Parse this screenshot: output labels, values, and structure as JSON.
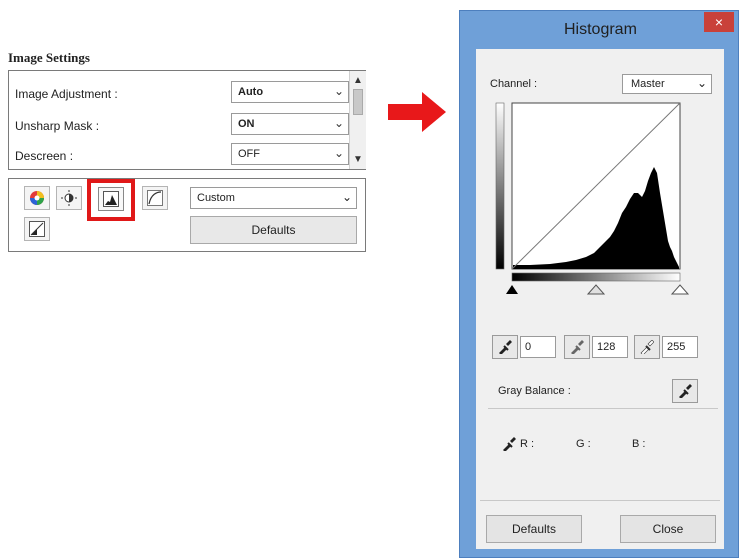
{
  "image_settings": {
    "title": "Image Settings",
    "rows": [
      {
        "label": "Image Adjustment :",
        "value": "Auto"
      },
      {
        "label": "Unsharp Mask :",
        "value": "ON"
      },
      {
        "label": "Descreen :",
        "value": "OFF"
      }
    ],
    "tone_preset": "Custom",
    "defaults_label": "Defaults",
    "tools": [
      "saturation-color-balance-icon",
      "brightness-contrast-icon",
      "histogram-icon",
      "tone-curve-icon",
      "threshold-icon"
    ]
  },
  "histogram": {
    "title": "Histogram",
    "close_label": "×",
    "channel_label": "Channel :",
    "channel_value": "Master",
    "black_point": "0",
    "mid_point": "128",
    "white_point": "255",
    "gray_balance_label": "Gray Balance :",
    "r_label": "R :",
    "g_label": "G :",
    "b_label": "B :",
    "defaults_label": "Defaults",
    "close_button_label": "Close"
  },
  "colors": {
    "window_frame": "#6fa0d8",
    "close_button": "#c9413a",
    "highlight": "#e01818",
    "arrow": "#e8181a"
  }
}
